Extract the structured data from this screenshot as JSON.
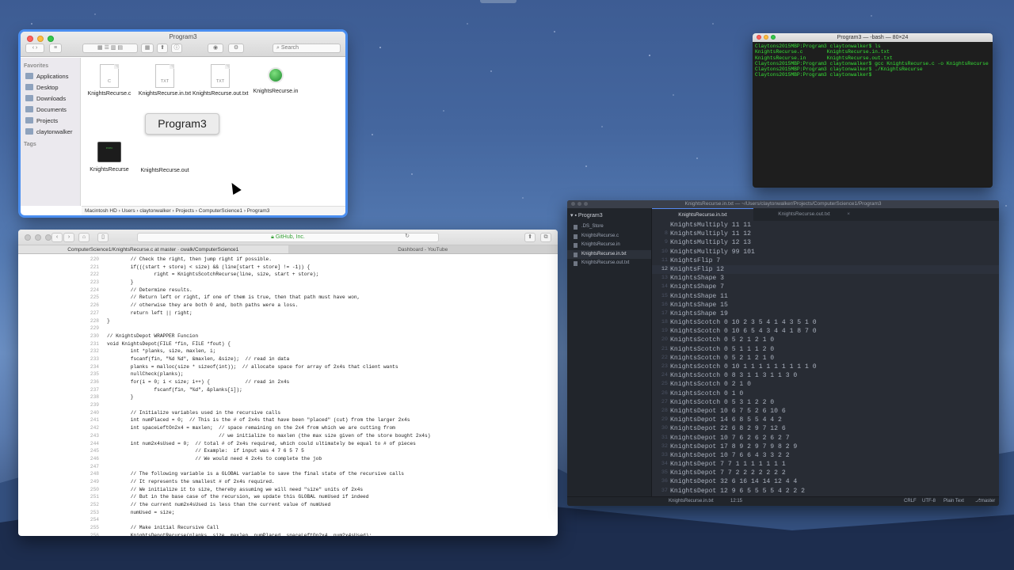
{
  "finder": {
    "title": "Program3",
    "search_placeholder": "Search",
    "sidebar": {
      "favorites_header": "Favorites",
      "tags_header": "Tags",
      "items": [
        "Applications",
        "Desktop",
        "Downloads",
        "Documents",
        "Projects",
        "claytonwalker"
      ]
    },
    "files": [
      {
        "name": "KnightsRecurse.c",
        "kind": "doc",
        "badge": "C"
      },
      {
        "name": "KnightsRecurse.in.txt",
        "kind": "doc",
        "badge": "TXT"
      },
      {
        "name": "KnightsRecurse.out.txt",
        "kind": "doc",
        "badge": "TXT"
      },
      {
        "name": "KnightsRecurse.in",
        "kind": "globe",
        "badge": ""
      },
      {
        "name": "KnightsRecurse",
        "kind": "exec",
        "badge": "exec"
      },
      {
        "name": "KnightsRecurse.out",
        "kind": "doc",
        "badge": ""
      }
    ],
    "rename_tooltip": "Program3",
    "path": "Macintosh HD  ›  Users  ›  claytonwalker  ›  Projects  ›  ComputerScience1  ›  Program3"
  },
  "terminal": {
    "title": "Program3 — -bash — 80×24",
    "lines": [
      "Claytons2015MBP:Program3 claytonwalker$ ls",
      "KnightsRecurse.c        KnightsRecurse.in.txt",
      "KnightsRecurse.in       KnightsRecurse.out.txt",
      "Claytons2015MBP:Program3 claytonwalker$ gcc KnightsRecurse.c -o KnightsRecurse",
      "Claytons2015MBP:Program3 claytonwalker$ ./KnightsRecurse",
      "Claytons2015MBP:Program3 claytonwalker$ "
    ]
  },
  "safari": {
    "url": "GitHub, Inc.",
    "tabs": [
      "ComputerScience1/KnightsRecurse.c at master · cwalk/ComputerScience1",
      "Dashboard - YouTube"
    ],
    "code_lines": [
      {
        "n": "220",
        "t": "        // Check the right, then jump right if possible."
      },
      {
        "n": "221",
        "t": "        if(((start + store) < size) && (line[start + store] != -1)) {"
      },
      {
        "n": "222",
        "t": "                right = KnightsScotchRecurse(line, size, start + store);"
      },
      {
        "n": "223",
        "t": "        }"
      },
      {
        "n": "224",
        "t": "        // Determine results."
      },
      {
        "n": "225",
        "t": "        // Return left or right, if one of them is true, then that path must have won,"
      },
      {
        "n": "226",
        "t": "        // otherwise they are both 0 and, both paths were a loss."
      },
      {
        "n": "227",
        "t": "        return left || right;"
      },
      {
        "n": "228",
        "t": "}"
      },
      {
        "n": "229",
        "t": ""
      },
      {
        "n": "230",
        "t": "// KnightsDepot WRAPPER Funcion"
      },
      {
        "n": "231",
        "t": "void KnightsDepot(FILE *fin, FILE *fout) {"
      },
      {
        "n": "232",
        "t": "        int *planks, size, maxlen, i;"
      },
      {
        "n": "233",
        "t": "        fscanf(fin, \"%d %d\", &maxlen, &size);  // read in data"
      },
      {
        "n": "234",
        "t": "        planks = malloc(size * sizeof(int));  // allocate space for array of 2x4s that client wants"
      },
      {
        "n": "235",
        "t": "        nullCheck(planks);"
      },
      {
        "n": "236",
        "t": "        for(i = 0; i < size; i++) {            // read in 2x4s"
      },
      {
        "n": "237",
        "t": "                fscanf(fin, \"%d\", &planks[i]);"
      },
      {
        "n": "238",
        "t": "        }"
      },
      {
        "n": "239",
        "t": ""
      },
      {
        "n": "240",
        "t": "        // Initialize variables used in the recursive calls"
      },
      {
        "n": "241",
        "t": "        int numPlaced = 0;  // This is the # of 2x4s that have been \"placed\" (cut) from the larger 2x4s"
      },
      {
        "n": "242",
        "t": "        int spaceLeftOn2x4 = maxlen;  // space remaining on the 2x4 from which we are cutting from"
      },
      {
        "n": "243",
        "t": "                                      // we initialize to maxlen (the max size given of the store bought 2x4s)"
      },
      {
        "n": "244",
        "t": "        int num2x4sUsed = 0;  // total # of 2x4s required, which could ultimately be equal to # of pieces"
      },
      {
        "n": "245",
        "t": "                              // Example:  if input was 4 7 6 5 7 5"
      },
      {
        "n": "246",
        "t": "                              // We would need 4 2x4s to complete the job"
      },
      {
        "n": "247",
        "t": ""
      },
      {
        "n": "248",
        "t": "        // The following variable is a GLOBAL variable to save the final state of the recursive calls"
      },
      {
        "n": "249",
        "t": "        // It represents the smallest # of 2x4s required."
      },
      {
        "n": "250",
        "t": "        // We initialize it to size, thereby assuming we will need \"size\" units of 2x4s"
      },
      {
        "n": "251",
        "t": "        // But in the base case of the recursion, we update this GLOBAL numUsed if indeed"
      },
      {
        "n": "252",
        "t": "        // the current num2x4sUsed is less than the current value of numUsed"
      },
      {
        "n": "253",
        "t": "        numUsed = size;"
      },
      {
        "n": "254",
        "t": ""
      },
      {
        "n": "255",
        "t": "        // Make initial Recursive Call"
      },
      {
        "n": "256",
        "t": "        KnightsDepotRecurse(planks, size, maxlen, numPlaced, spaceLeftOn2x4, num2x4sUsed);"
      }
    ]
  },
  "atom": {
    "title": "KnightsRecurse.in.txt — ~/Users/claytonwalker/Projects/ComputerScience1/Program3",
    "project": "Program3",
    "tree_files": [
      ".DS_Store",
      "KnightsRecurse.c",
      "KnightsRecurse.in",
      "KnightsRecurse.in.txt",
      "KnightsRecurse.out.txt"
    ],
    "tabs": [
      "KnightsRecurse.in.txt",
      "KnightsRecurse.out.txt"
    ],
    "lines": [
      {
        "n": "",
        "t": "KnightsMultiply 11 11"
      },
      {
        "n": "8",
        "t": "KnightsMultiply 11 12"
      },
      {
        "n": "9",
        "t": "KnightsMultiply 12 13"
      },
      {
        "n": "10",
        "t": "KnightsMultiply 99 101"
      },
      {
        "n": "11",
        "t": "KnightsFlip 7"
      },
      {
        "n": "12",
        "t": "KnightsFlip 12"
      },
      {
        "n": "13",
        "t": "KnightsShape 3"
      },
      {
        "n": "14",
        "t": "KnightsShape 7"
      },
      {
        "n": "15",
        "t": "KnightsShape 11"
      },
      {
        "n": "16",
        "t": "KnightsShape 15"
      },
      {
        "n": "17",
        "t": "KnightsShape 19"
      },
      {
        "n": "18",
        "t": "KnightsScotch 0 10 2 3 5 4 1 4 3 5 1 0"
      },
      {
        "n": "19",
        "t": "KnightsScotch 0 10 6 5 4 3 4 4 1 8 7 0"
      },
      {
        "n": "20",
        "t": "KnightsScotch 0 5 2 1 2 1 0"
      },
      {
        "n": "21",
        "t": "KnightsScotch 0 5 1 1 1 2 0"
      },
      {
        "n": "22",
        "t": "KnightsScotch 0 5 2 1 2 1 0"
      },
      {
        "n": "23",
        "t": "KnightsScotch 0 10 1 1 1 1 1 1 1 1 1 0"
      },
      {
        "n": "24",
        "t": "KnightsScotch 0 8 3 1 1 3 1 1 3 0"
      },
      {
        "n": "25",
        "t": "KnightsScotch 0 2 1 0"
      },
      {
        "n": "26",
        "t": "KnightsScotch 0 1 0"
      },
      {
        "n": "27",
        "t": "KnightsScotch 0 5 3 1 2 2 0"
      },
      {
        "n": "28",
        "t": "KnightsDepot 10 6 7 5 2 6 10 6"
      },
      {
        "n": "29",
        "t": "KnightsDepot 14 6 8 5 5 4 4 2"
      },
      {
        "n": "30",
        "t": "KnightsDepot 22 6 8 2 9 7 12 6"
      },
      {
        "n": "31",
        "t": "KnightsDepot 10 7 6 2 6 2 6 2 7"
      },
      {
        "n": "32",
        "t": "KnightsDepot 17 8 9 2 9 7 9 8 2 9"
      },
      {
        "n": "33",
        "t": "KnightsDepot 10 7 6 6 4 3 3 2 2"
      },
      {
        "n": "34",
        "t": "KnightsDepot 7 7 1 1 1 1 1 1 1"
      },
      {
        "n": "35",
        "t": "KnightsDepot 7 7 2 2 2 2 2 2 2"
      },
      {
        "n": "36",
        "t": "KnightsDepot 32 6 16 14 14 12 4 4"
      },
      {
        "n": "37",
        "t": "KnightsDepot 12 9 6 5 5 5 5 4 2 2 2"
      }
    ],
    "current_line": "12",
    "status": {
      "file": "KnightsRecurse.in.txt",
      "cursor": "12:15",
      "eol": "CRLF",
      "encoding": "UTF-8",
      "grammar": "Plain Text",
      "branch": "master"
    }
  }
}
